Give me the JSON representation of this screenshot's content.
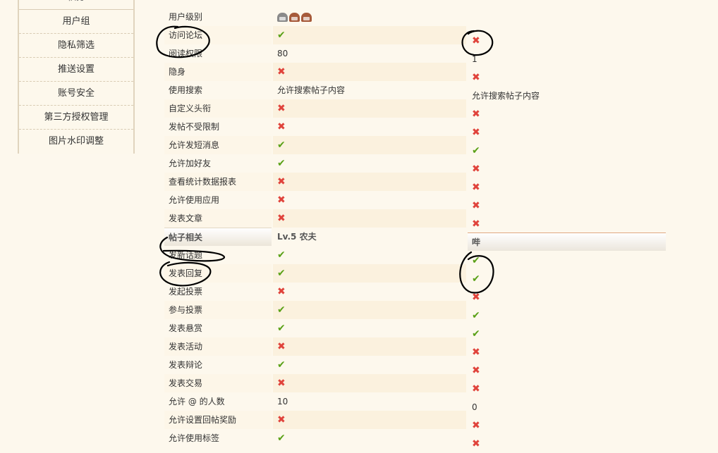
{
  "sidebar": {
    "items": [
      {
        "label": "积分"
      },
      {
        "label": "用户组"
      },
      {
        "label": "隐私筛选"
      },
      {
        "label": "推送设置"
      },
      {
        "label": "账号安全"
      },
      {
        "label": "第三方授权管理"
      },
      {
        "label": "图片水印调整"
      }
    ]
  },
  "table": {
    "section_header": {
      "label": "帖子相关",
      "value1": "Lv.5 农夫",
      "value2": "哔"
    },
    "rows": [
      {
        "label": "用户级别",
        "v1": "level-icons",
        "v2": ""
      },
      {
        "label": "访问论坛",
        "v1": "ok",
        "v2": "no"
      },
      {
        "label": "阅读权限",
        "v1": "80",
        "v2": "1"
      },
      {
        "label": "隐身",
        "v1": "no",
        "v2": "no"
      },
      {
        "label": "使用搜索",
        "v1": "允许搜索帖子内容",
        "v2": "允许搜索帖子内容"
      },
      {
        "label": "自定义头衔",
        "v1": "no",
        "v2": "no"
      },
      {
        "label": "发帖不受限制",
        "v1": "no",
        "v2": "no"
      },
      {
        "label": "允许发短消息",
        "v1": "ok",
        "v2": "ok"
      },
      {
        "label": "允许加好友",
        "v1": "ok",
        "v2": "no"
      },
      {
        "label": "查看统计数据报表",
        "v1": "no",
        "v2": "no"
      },
      {
        "label": "允许使用应用",
        "v1": "no",
        "v2": "no"
      },
      {
        "label": "发表文章",
        "v1": "no",
        "v2": "no"
      }
    ],
    "rows2": [
      {
        "label": "发新话题",
        "v1": "ok",
        "v2": "ok"
      },
      {
        "label": "发表回复",
        "v1": "ok",
        "v2": "ok"
      },
      {
        "label": "发起投票",
        "v1": "no",
        "v2": "no"
      },
      {
        "label": "参与投票",
        "v1": "ok",
        "v2": "ok"
      },
      {
        "label": "发表悬赏",
        "v1": "ok",
        "v2": "ok"
      },
      {
        "label": "发表活动",
        "v1": "no",
        "v2": "no"
      },
      {
        "label": "发表辩论",
        "v1": "ok",
        "v2": "no"
      },
      {
        "label": "发表交易",
        "v1": "no",
        "v2": "no"
      },
      {
        "label": "允许 @ 的人数",
        "v1": "10",
        "v2": "0"
      },
      {
        "label": "允许设置回帖奖励",
        "v1": "no",
        "v2": "no"
      },
      {
        "label": "允许使用标签",
        "v1": "ok",
        "v2": "no"
      }
    ]
  },
  "icons": {
    "ok": "check-icon",
    "no": "cross-icon"
  },
  "colors": {
    "ok": "#5aa117",
    "no": "#e0433b",
    "annotation": "#000000"
  }
}
